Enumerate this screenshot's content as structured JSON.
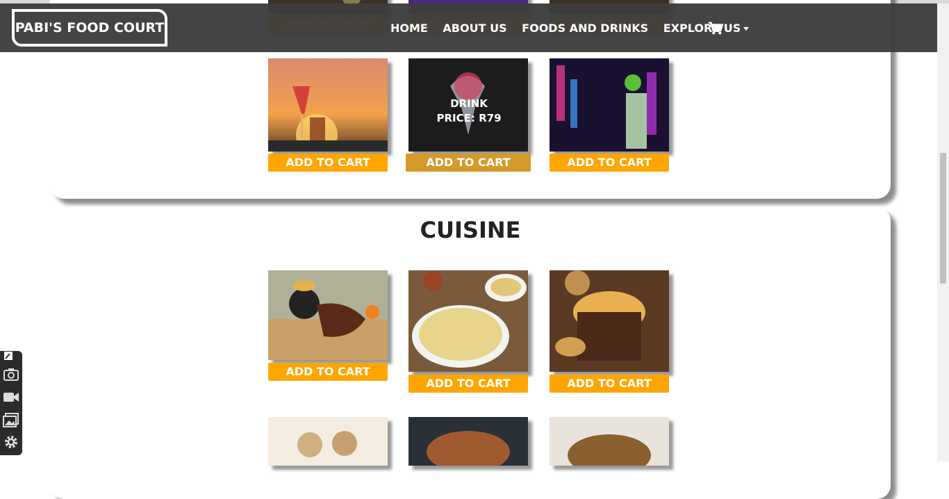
{
  "brand": "PABI'S FOOD COURT",
  "nav": {
    "home": "HOME",
    "about": "ABOUT US",
    "foods": "FOODS AND DRINKS",
    "explore": "EXPLORE US"
  },
  "add_to_cart": "ADD TO CART",
  "drink_hover": {
    "name": "DRINK",
    "price": "PRICE: R79"
  },
  "cuisine_title": "CUISINE",
  "icons": [
    "cart-icon",
    "pin-icon",
    "camera-icon",
    "video-icon",
    "gallery-icon",
    "gear-icon"
  ]
}
